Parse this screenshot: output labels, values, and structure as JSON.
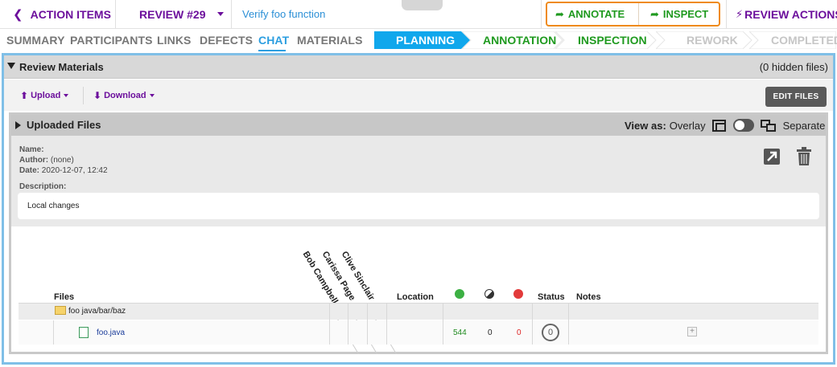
{
  "topbar": {
    "back_label": "ACTION ITEMS",
    "review_label": "REVIEW #29",
    "review_title": "Verify foo function",
    "annotate_label": "ANNOTATE",
    "inspect_label": "INSPECT",
    "review_actions_label": "REVIEW ACTIONS"
  },
  "tabs": [
    "SUMMARY",
    "PARTICIPANTS",
    "LINKS",
    "DEFECTS",
    "CHAT",
    "MATERIALS"
  ],
  "active_tab": "CHAT",
  "workflow": [
    {
      "label": "PLANNING",
      "state": "current"
    },
    {
      "label": "ANNOTATION",
      "state": "upcoming"
    },
    {
      "label": "INSPECTION",
      "state": "upcoming"
    },
    {
      "label": "REWORK",
      "state": "disabled"
    },
    {
      "label": "COMPLETED",
      "state": "disabled"
    }
  ],
  "materials": {
    "title": "Review Materials",
    "hidden_files": "(0 hidden files)",
    "upload_label": "Upload",
    "download_label": "Download",
    "edit_files_label": "EDIT FILES"
  },
  "uploaded": {
    "title": "Uploaded Files",
    "view_as_label": "View as:",
    "overlay_label": "Overlay",
    "separate_label": "Separate",
    "name_label": "Name:",
    "name_value": "",
    "author_label": "Author:",
    "author_value": "(none)",
    "date_label": "Date:",
    "date_value": "2020-12-07, 12:42",
    "description_label": "Description:",
    "description_value": "Local changes"
  },
  "grid": {
    "files_header": "Files",
    "participants": [
      "Bob Campbell",
      "Carissa Page",
      "Clive Sinclair"
    ],
    "location_header": "Location",
    "status_header": "Status",
    "notes_header": "Notes",
    "folder": "foo java/bar/baz",
    "file": {
      "name": "foo.java",
      "added": "544",
      "modified": "0",
      "removed": "0",
      "status": "0"
    }
  },
  "colors": {
    "brand_purple": "#6c0f9c",
    "accent_blue": "#2b9ee0",
    "action_green": "#1f9a1f",
    "highlight_orange": "#ef8a18"
  }
}
